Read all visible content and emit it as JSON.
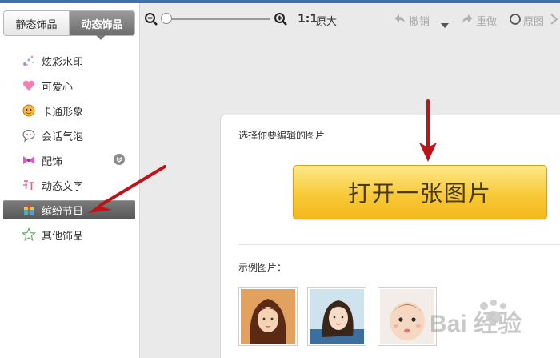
{
  "tabs": {
    "static_label": "静态饰品",
    "dynamic_label": "动态饰品"
  },
  "menu": [
    {
      "label": "炫彩水印",
      "icon": "sparkle-icon"
    },
    {
      "label": "可爱心",
      "icon": "heart-icon"
    },
    {
      "label": "卡通形象",
      "icon": "cartoon-face-icon"
    },
    {
      "label": "会话气泡",
      "icon": "speech-bubble-icon"
    },
    {
      "label": "配饰",
      "icon": "bow-icon"
    },
    {
      "label": "动态文字",
      "icon": "animated-text-icon"
    },
    {
      "label": "缤纷节日",
      "icon": "gift-icon",
      "active": true
    },
    {
      "label": "其他饰品",
      "icon": "star-icon"
    }
  ],
  "toolbar": {
    "ratio_label": "1:1",
    "original_size_label": "原大",
    "undo_label": "撤销",
    "redo_label": "重做",
    "original_label": "原图",
    "zoom_level": 0
  },
  "main": {
    "prompt": "选择你要编辑的图片",
    "open_button_label": "打开一张图片",
    "samples_label": "示例图片："
  },
  "watermark": {
    "text": "Bai 经验"
  },
  "colors": {
    "accent_red": "#c0121a",
    "button_yellow": "#f8c93a",
    "active_gray": "#6a6a6a"
  }
}
